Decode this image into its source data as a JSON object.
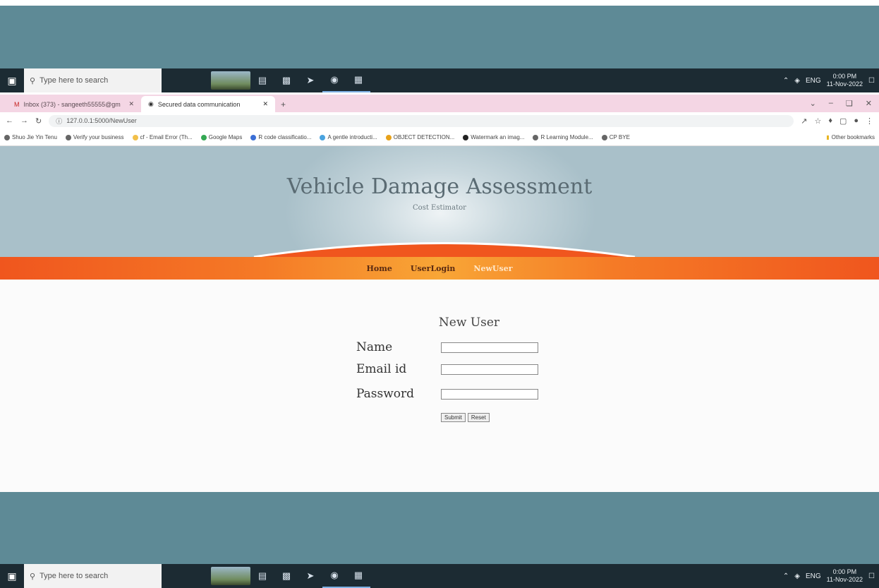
{
  "taskbar": {
    "search_placeholder": "Type here to search",
    "clock_time": "0:00 PM",
    "clock_date": "11-Nov-2022",
    "tray_text": "ENG"
  },
  "browser": {
    "tabs": [
      {
        "label": "Inbox (373) - sangeeth55555@gm",
        "active": false
      },
      {
        "label": "Secured data communication",
        "active": true
      }
    ],
    "url": "127.0.0.1:5000/NewUser",
    "bookmarks": [
      "Shuo Jie Yin Tenu",
      "Verify your business",
      "cf - Email Error (Th...",
      "Google Maps",
      "R code classificatio...",
      "A gentle introducti...",
      "OBJECT DETECTION...",
      "Watermark an imag...",
      "R Learning Module...",
      "CP BYE"
    ],
    "other_bookmarks": "Other bookmarks"
  },
  "site": {
    "title": "Vehicle Damage Assessment",
    "subtitle": "Cost Estimator",
    "nav": [
      {
        "label": "Home",
        "current": false
      },
      {
        "label": "UserLogin",
        "current": false
      },
      {
        "label": "NewUser",
        "current": true
      }
    ]
  },
  "form": {
    "title": "New User",
    "name_label": "Name",
    "email_label": "Email id",
    "password_label": "Password",
    "submit_label": "Submit",
    "reset_label": "Reset"
  },
  "colors": {
    "desktop_bg": "#5e8a96",
    "nav_orange": "#f0561e",
    "nav_center": "#f8a636",
    "tab_strip": "#f4d6e4"
  }
}
